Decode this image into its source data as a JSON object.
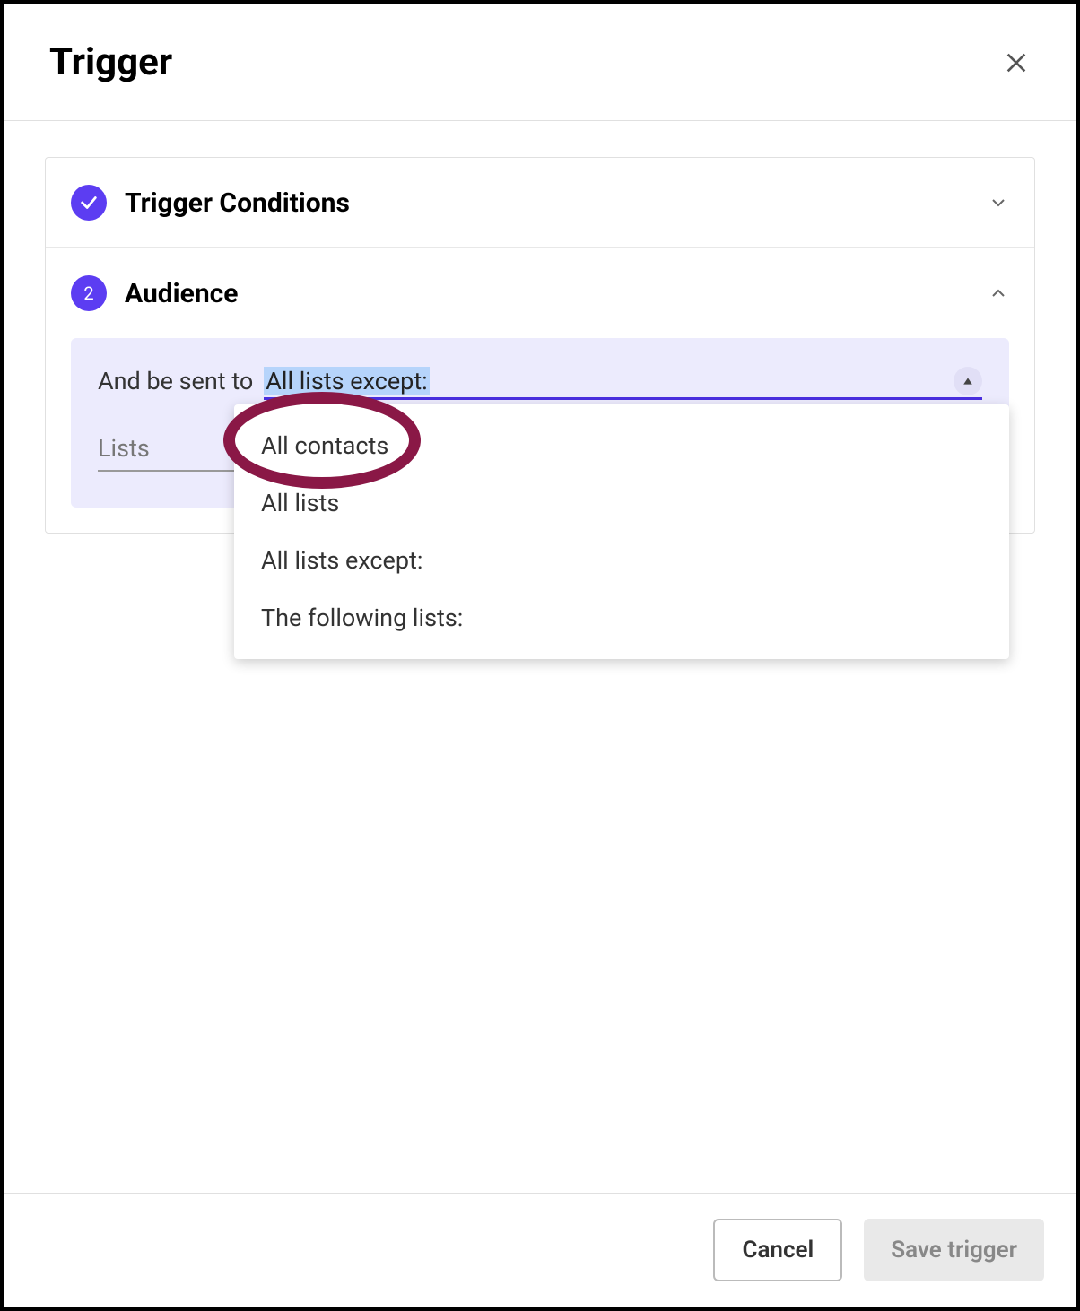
{
  "header": {
    "title": "Trigger"
  },
  "sections": {
    "trigger_conditions": {
      "title": "Trigger Conditions"
    },
    "audience": {
      "badge": "2",
      "title": "Audience",
      "sent_to_label": "And be sent to",
      "selected_value": "All lists except:",
      "lists_label": "Lists",
      "options": [
        "All contacts",
        "All lists",
        "All lists except:",
        "The following lists:"
      ]
    }
  },
  "footer": {
    "cancel": "Cancel",
    "save": "Save trigger"
  },
  "colors": {
    "accent": "#5c3df2",
    "highlight": "#8a1846"
  }
}
